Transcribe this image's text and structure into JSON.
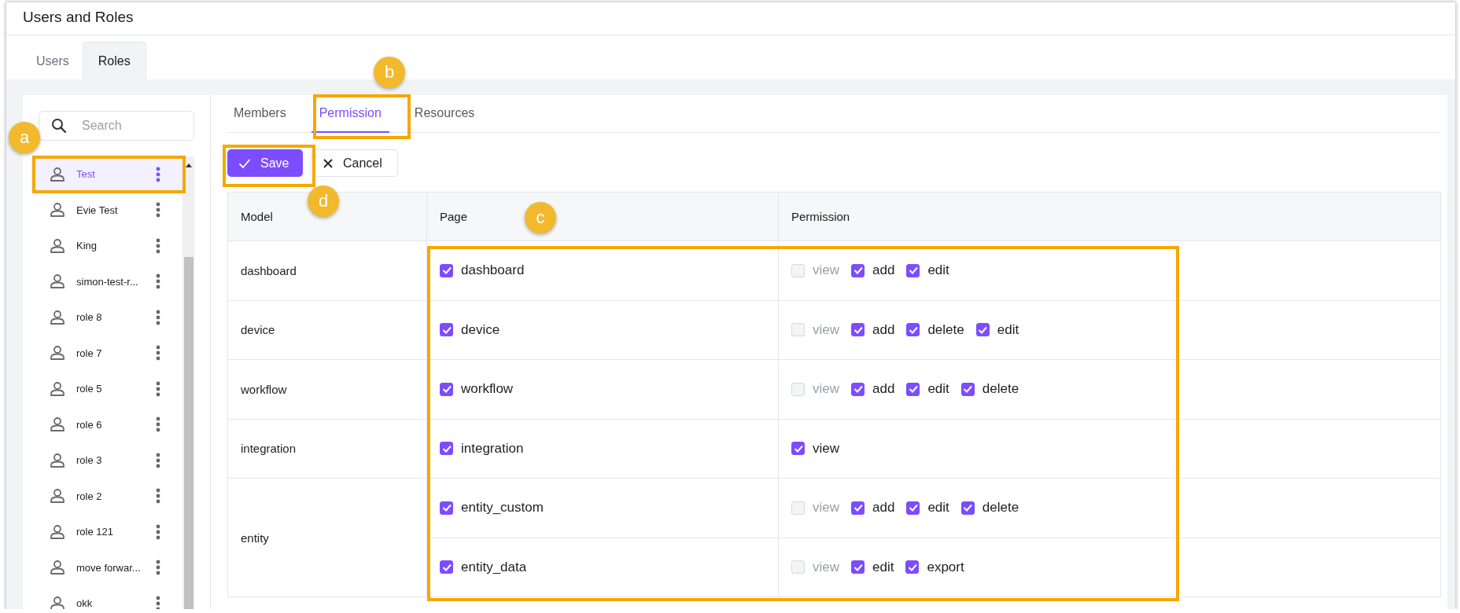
{
  "page": {
    "title": "Users and Roles"
  },
  "tabs": [
    {
      "label": "Users",
      "selected": false
    },
    {
      "label": "Roles",
      "selected": true
    }
  ],
  "sidebar": {
    "search": {
      "placeholder": "Search"
    },
    "roles": [
      {
        "name": "Test",
        "selected": true
      },
      {
        "name": "Evie Test",
        "selected": false
      },
      {
        "name": "King",
        "selected": false
      },
      {
        "name": "simon-test-r...",
        "selected": false
      },
      {
        "name": "role 8",
        "selected": false
      },
      {
        "name": "role 7",
        "selected": false
      },
      {
        "name": "role 5",
        "selected": false
      },
      {
        "name": "role 6",
        "selected": false
      },
      {
        "name": "role 3",
        "selected": false
      },
      {
        "name": "role 2",
        "selected": false
      },
      {
        "name": "role 121",
        "selected": false
      },
      {
        "name": "move forwar...",
        "selected": false
      },
      {
        "name": "okk",
        "selected": false
      }
    ]
  },
  "detail_tabs": [
    {
      "label": "Members",
      "selected": false
    },
    {
      "label": "Permission",
      "selected": true
    },
    {
      "label": "Resources",
      "selected": false
    }
  ],
  "buttons": [
    {
      "label": "Save",
      "kind": "primary"
    },
    {
      "label": "Cancel",
      "kind": "secondary"
    }
  ],
  "table": {
    "columns": [
      "Model",
      "Page",
      "Permission"
    ],
    "models": [
      {
        "name": "dashboard",
        "pages": [
          {
            "name": "dashboard",
            "checked": true,
            "permissions": [
              {
                "label": "view",
                "checked": false,
                "disabled": true
              },
              {
                "label": "add",
                "checked": true,
                "disabled": false
              },
              {
                "label": "edit",
                "checked": true,
                "disabled": false
              }
            ]
          }
        ]
      },
      {
        "name": "device",
        "pages": [
          {
            "name": "device",
            "checked": true,
            "permissions": [
              {
                "label": "view",
                "checked": false,
                "disabled": true
              },
              {
                "label": "add",
                "checked": true,
                "disabled": false
              },
              {
                "label": "delete",
                "checked": true,
                "disabled": false
              },
              {
                "label": "edit",
                "checked": true,
                "disabled": false
              }
            ]
          }
        ]
      },
      {
        "name": "workflow",
        "pages": [
          {
            "name": "workflow",
            "checked": true,
            "permissions": [
              {
                "label": "view",
                "checked": false,
                "disabled": true
              },
              {
                "label": "add",
                "checked": true,
                "disabled": false
              },
              {
                "label": "edit",
                "checked": true,
                "disabled": false
              },
              {
                "label": "delete",
                "checked": true,
                "disabled": false
              }
            ]
          }
        ]
      },
      {
        "name": "integration",
        "pages": [
          {
            "name": "integration",
            "checked": true,
            "permissions": [
              {
                "label": "view",
                "checked": true,
                "disabled": false
              }
            ]
          }
        ]
      },
      {
        "name": "entity",
        "pages": [
          {
            "name": "entity_custom",
            "checked": true,
            "permissions": [
              {
                "label": "view",
                "checked": false,
                "disabled": true
              },
              {
                "label": "add",
                "checked": true,
                "disabled": false
              },
              {
                "label": "edit",
                "checked": true,
                "disabled": false
              },
              {
                "label": "delete",
                "checked": true,
                "disabled": false
              }
            ]
          },
          {
            "name": "entity_data",
            "checked": true,
            "permissions": [
              {
                "label": "view",
                "checked": false,
                "disabled": true
              },
              {
                "label": "edit",
                "checked": true,
                "disabled": false
              },
              {
                "label": "export",
                "checked": true,
                "disabled": false
              }
            ]
          }
        ]
      }
    ]
  },
  "callouts": [
    {
      "label": "a"
    },
    {
      "label": "b"
    },
    {
      "label": "c"
    },
    {
      "label": "d"
    }
  ]
}
